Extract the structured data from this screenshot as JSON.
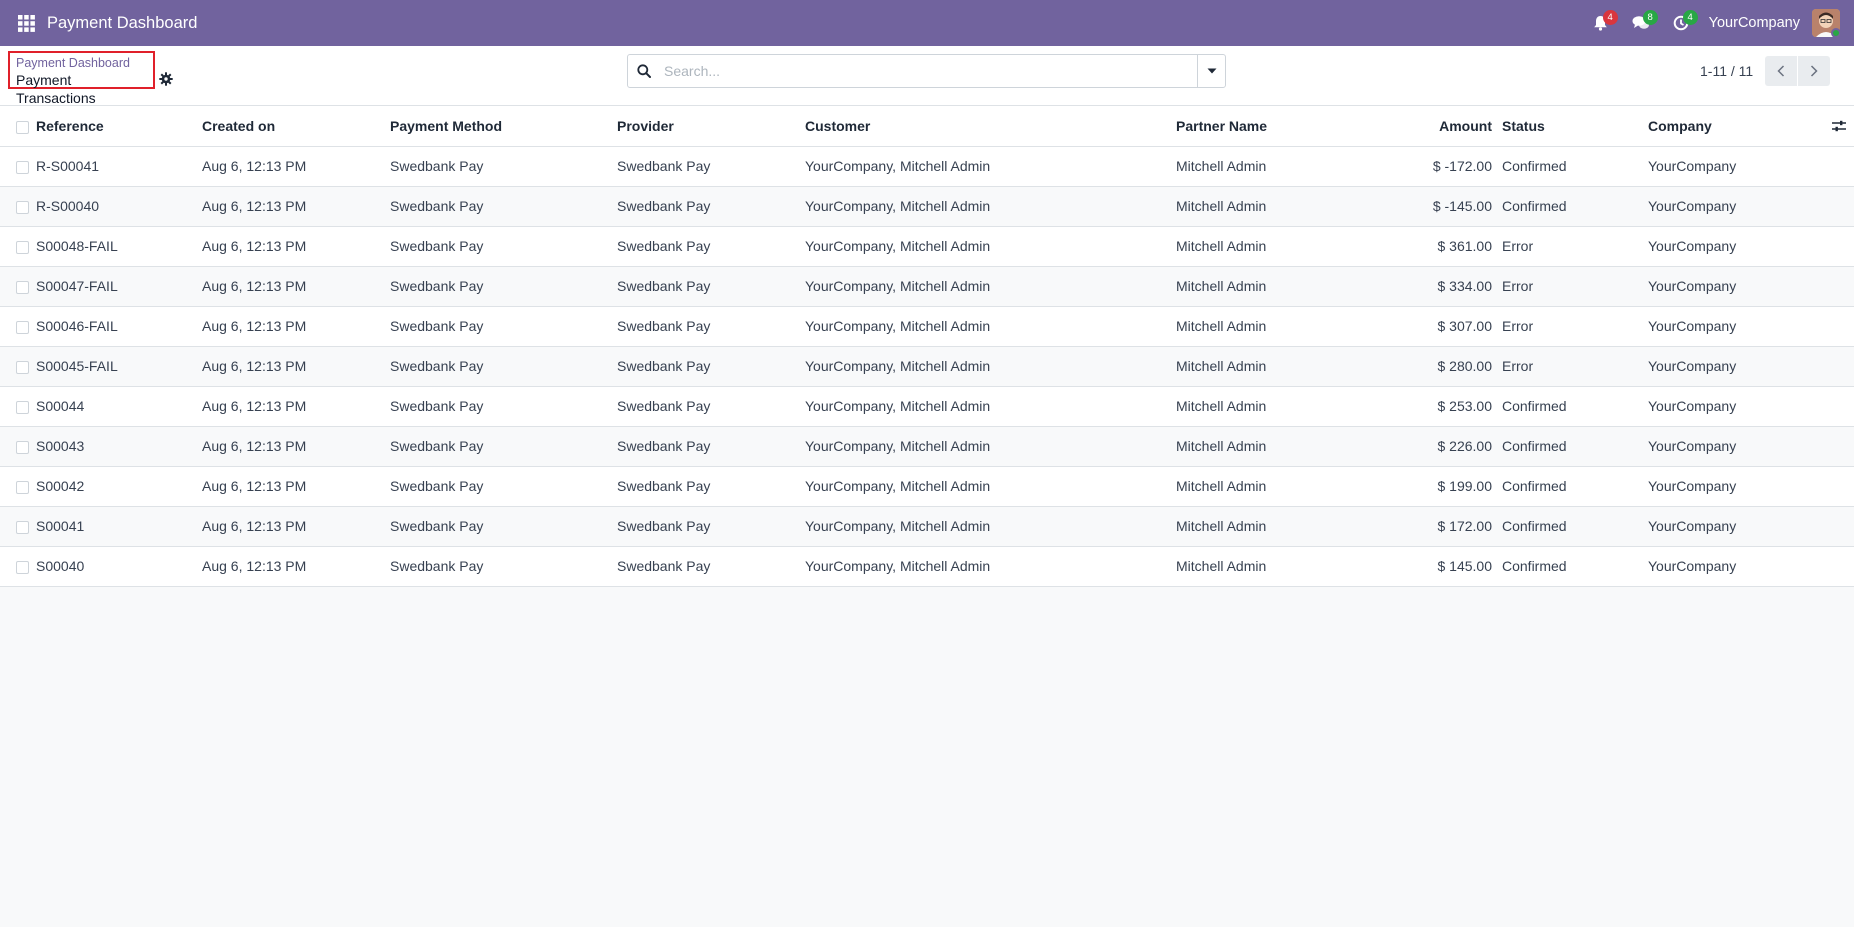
{
  "navbar": {
    "app_title": "Payment Dashboard",
    "company": "YourCompany",
    "activity_count": "4",
    "messages_count": "8",
    "timer_count": "4",
    "brand_color": "#71639e"
  },
  "breadcrumb": {
    "parent": "Payment Dashboard",
    "current": "Payment Transactions"
  },
  "search": {
    "placeholder": "Search...",
    "value": ""
  },
  "pager": {
    "value": "1-11 / 11"
  },
  "table": {
    "headers": {
      "reference": "Reference",
      "created_on": "Created on",
      "payment_method": "Payment Method",
      "provider": "Provider",
      "customer": "Customer",
      "partner_name": "Partner Name",
      "amount": "Amount",
      "status": "Status",
      "company": "Company"
    },
    "rows": [
      {
        "reference": "R-S00041",
        "created_on": "Aug 6, 12:13 PM",
        "payment_method": "Swedbank Pay",
        "provider": "Swedbank Pay",
        "customer": "YourCompany, Mitchell Admin",
        "partner_name": "Mitchell Admin",
        "amount": "$ -172.00",
        "status": "Confirmed",
        "company": "YourCompany"
      },
      {
        "reference": "R-S00040",
        "created_on": "Aug 6, 12:13 PM",
        "payment_method": "Swedbank Pay",
        "provider": "Swedbank Pay",
        "customer": "YourCompany, Mitchell Admin",
        "partner_name": "Mitchell Admin",
        "amount": "$ -145.00",
        "status": "Confirmed",
        "company": "YourCompany"
      },
      {
        "reference": "S00048-FAIL",
        "created_on": "Aug 6, 12:13 PM",
        "payment_method": "Swedbank Pay",
        "provider": "Swedbank Pay",
        "customer": "YourCompany, Mitchell Admin",
        "partner_name": "Mitchell Admin",
        "amount": "$ 361.00",
        "status": "Error",
        "company": "YourCompany"
      },
      {
        "reference": "S00047-FAIL",
        "created_on": "Aug 6, 12:13 PM",
        "payment_method": "Swedbank Pay",
        "provider": "Swedbank Pay",
        "customer": "YourCompany, Mitchell Admin",
        "partner_name": "Mitchell Admin",
        "amount": "$ 334.00",
        "status": "Error",
        "company": "YourCompany"
      },
      {
        "reference": "S00046-FAIL",
        "created_on": "Aug 6, 12:13 PM",
        "payment_method": "Swedbank Pay",
        "provider": "Swedbank Pay",
        "customer": "YourCompany, Mitchell Admin",
        "partner_name": "Mitchell Admin",
        "amount": "$ 307.00",
        "status": "Error",
        "company": "YourCompany"
      },
      {
        "reference": "S00045-FAIL",
        "created_on": "Aug 6, 12:13 PM",
        "payment_method": "Swedbank Pay",
        "provider": "Swedbank Pay",
        "customer": "YourCompany, Mitchell Admin",
        "partner_name": "Mitchell Admin",
        "amount": "$ 280.00",
        "status": "Error",
        "company": "YourCompany"
      },
      {
        "reference": "S00044",
        "created_on": "Aug 6, 12:13 PM",
        "payment_method": "Swedbank Pay",
        "provider": "Swedbank Pay",
        "customer": "YourCompany, Mitchell Admin",
        "partner_name": "Mitchell Admin",
        "amount": "$ 253.00",
        "status": "Confirmed",
        "company": "YourCompany"
      },
      {
        "reference": "S00043",
        "created_on": "Aug 6, 12:13 PM",
        "payment_method": "Swedbank Pay",
        "provider": "Swedbank Pay",
        "customer": "YourCompany, Mitchell Admin",
        "partner_name": "Mitchell Admin",
        "amount": "$ 226.00",
        "status": "Confirmed",
        "company": "YourCompany"
      },
      {
        "reference": "S00042",
        "created_on": "Aug 6, 12:13 PM",
        "payment_method": "Swedbank Pay",
        "provider": "Swedbank Pay",
        "customer": "YourCompany, Mitchell Admin",
        "partner_name": "Mitchell Admin",
        "amount": "$ 199.00",
        "status": "Confirmed",
        "company": "YourCompany"
      },
      {
        "reference": "S00041",
        "created_on": "Aug 6, 12:13 PM",
        "payment_method": "Swedbank Pay",
        "provider": "Swedbank Pay",
        "customer": "YourCompany, Mitchell Admin",
        "partner_name": "Mitchell Admin",
        "amount": "$ 172.00",
        "status": "Confirmed",
        "company": "YourCompany"
      },
      {
        "reference": "S00040",
        "created_on": "Aug 6, 12:13 PM",
        "payment_method": "Swedbank Pay",
        "provider": "Swedbank Pay",
        "customer": "YourCompany, Mitchell Admin",
        "partner_name": "Mitchell Admin",
        "amount": "$ 145.00",
        "status": "Confirmed",
        "company": "YourCompany"
      }
    ]
  }
}
